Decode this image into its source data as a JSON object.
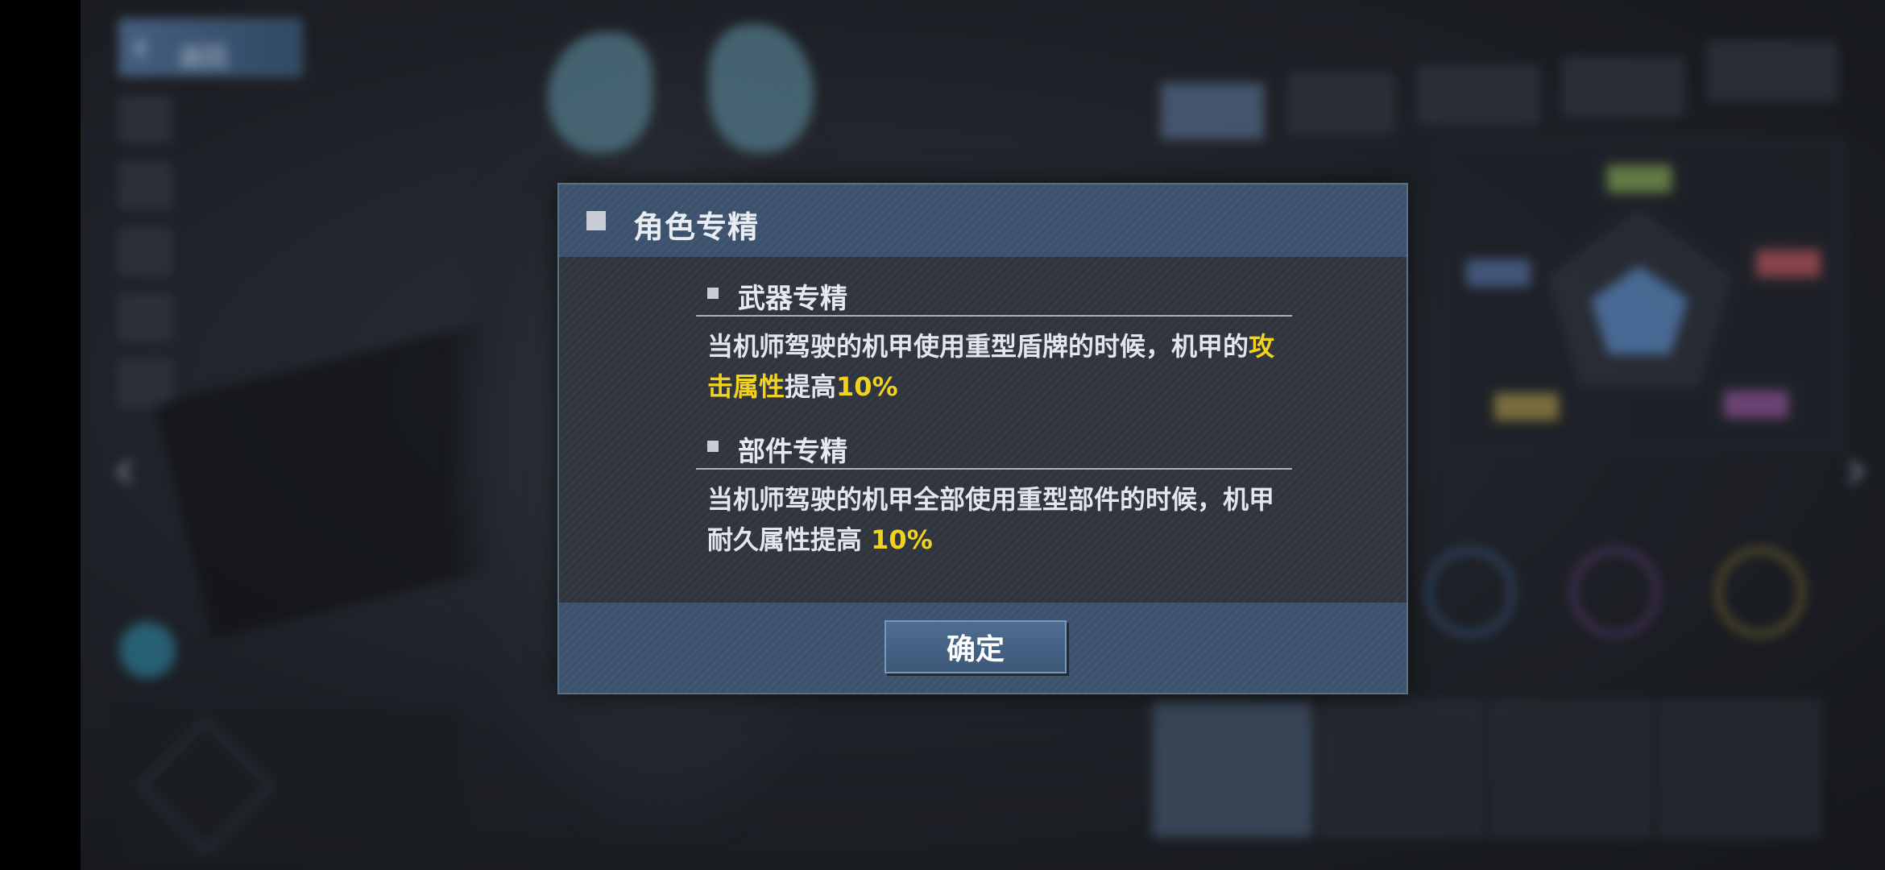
{
  "background": {
    "back_label": "返回",
    "nav_prev": "‹",
    "nav_next": "›"
  },
  "dialog": {
    "title": "角色专精",
    "sections": [
      {
        "title": "武器专精",
        "text_before": "当机师驾驶的机甲使用重型盾牌的时候，机甲的",
        "highlight": "攻击属性",
        "text_middle": "提高",
        "value": "10%"
      },
      {
        "title": "部件专精",
        "text_before": "当机师驾驶的机甲全部使用重型部件的时候，机甲耐久属性提高 ",
        "value": "10%"
      }
    ],
    "confirm_label": "确定"
  },
  "colors": {
    "highlight": "#f0d21f",
    "header_bg": "#3b516c",
    "dialog_bg": "#30343d"
  }
}
